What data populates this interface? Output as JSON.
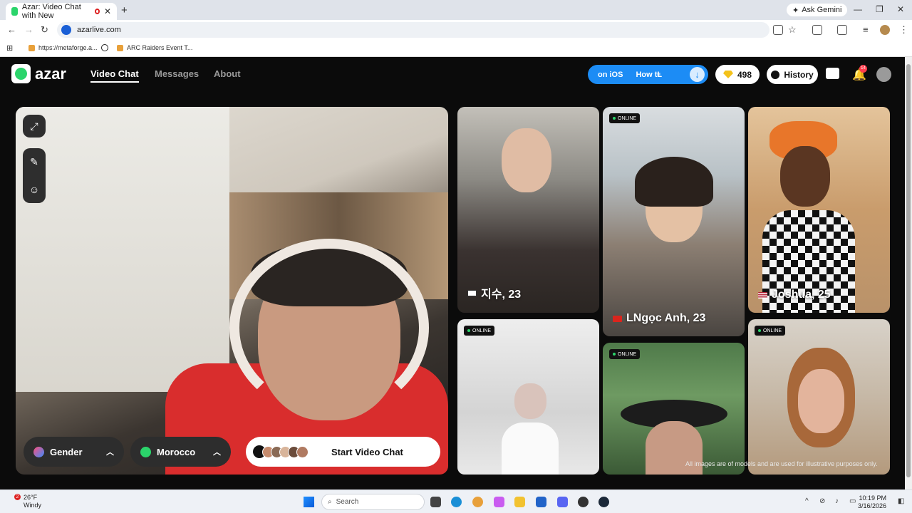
{
  "browser": {
    "tab_title": "Azar: Video Chat with New",
    "new_tab": "+",
    "ask_gemini": "Ask Gemini",
    "url": "azarlive.com",
    "bookmarks": [
      "https://metaforge.a...",
      "ARC Raiders Event T..."
    ]
  },
  "site": {
    "logo_text": "azar",
    "nav": [
      "Video Chat",
      "Messages",
      "About"
    ],
    "promo": {
      "part1": "on iOS",
      "part2": "How tⱠ"
    },
    "gems": "498",
    "history_label": "History",
    "notification_count": "14"
  },
  "cam": {
    "gender_label": "Gender",
    "country_label": "Morocco",
    "start_label": "Start Video Chat"
  },
  "profiles": [
    {
      "name": "지수, 23",
      "online": false,
      "flag_color": "#ffffff"
    },
    {
      "name": "LNgọc Anh, 23",
      "online": true,
      "flag_color": "#da251d"
    },
    {
      "name": "Joshua, 25",
      "online": false,
      "flag_color": "#b22234"
    },
    {
      "name": "",
      "online": true
    },
    {
      "name": "",
      "online": true
    },
    {
      "name": "",
      "online": true
    }
  ],
  "online_label": "ONLINE",
  "disclaimer": "All images are of models and are used for illustrative purposes only.",
  "taskbar": {
    "weather_temp": "26°F",
    "weather_desc": "Windy",
    "weather_badge": "2",
    "search_placeholder": "Search",
    "time": "10:19 PM",
    "date": "3/16/2026"
  },
  "colors": {
    "brand_green": "#2bd46b",
    "promo_blue": "#1c8cf5",
    "shirt_red": "#d92d2d"
  }
}
